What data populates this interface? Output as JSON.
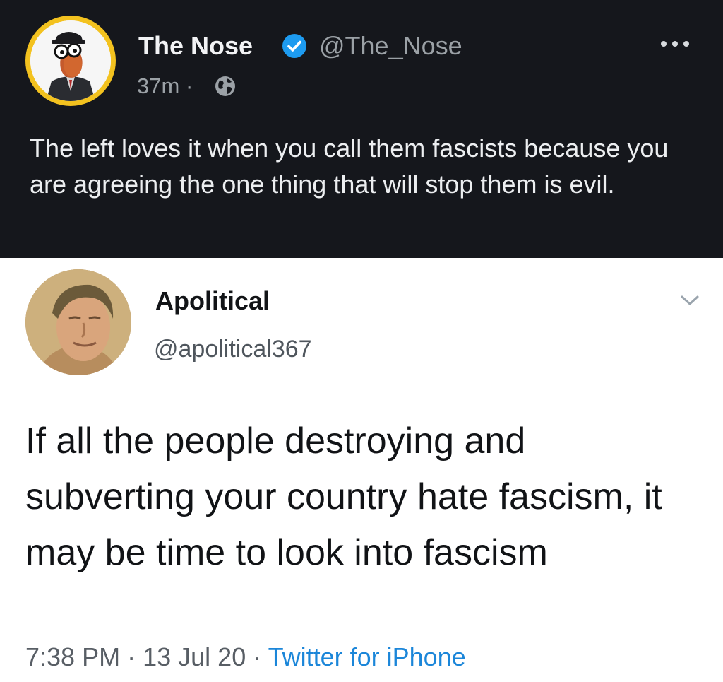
{
  "quote_tweet": {
    "author_name": "The Nose",
    "handle": "@The_Nose",
    "time": "37m",
    "separator": "·",
    "text": "The left loves it when you call them fascists because you are agreeing the one thing that will stop them is evil.",
    "icons": [
      "verified-badge-icon",
      "globe-icon",
      "more-options-icon"
    ],
    "colors": {
      "background": "#15171c",
      "verified": "#1d9bf0",
      "avatar_ring": "#f3c21f"
    }
  },
  "embedded_tweet": {
    "author_name": "Apolitical",
    "handle": "@apolitical367",
    "text": "If all the people destroying and subverting your country hate fascism, it may be time to look into fascism",
    "time": "7:38 PM",
    "date": "13 Jul 20",
    "source": "Twitter for iPhone",
    "separator": "·",
    "icons": [
      "chevron-down-icon"
    ],
    "colors": {
      "background": "#ffffff",
      "source_link": "#1b86d9"
    }
  }
}
